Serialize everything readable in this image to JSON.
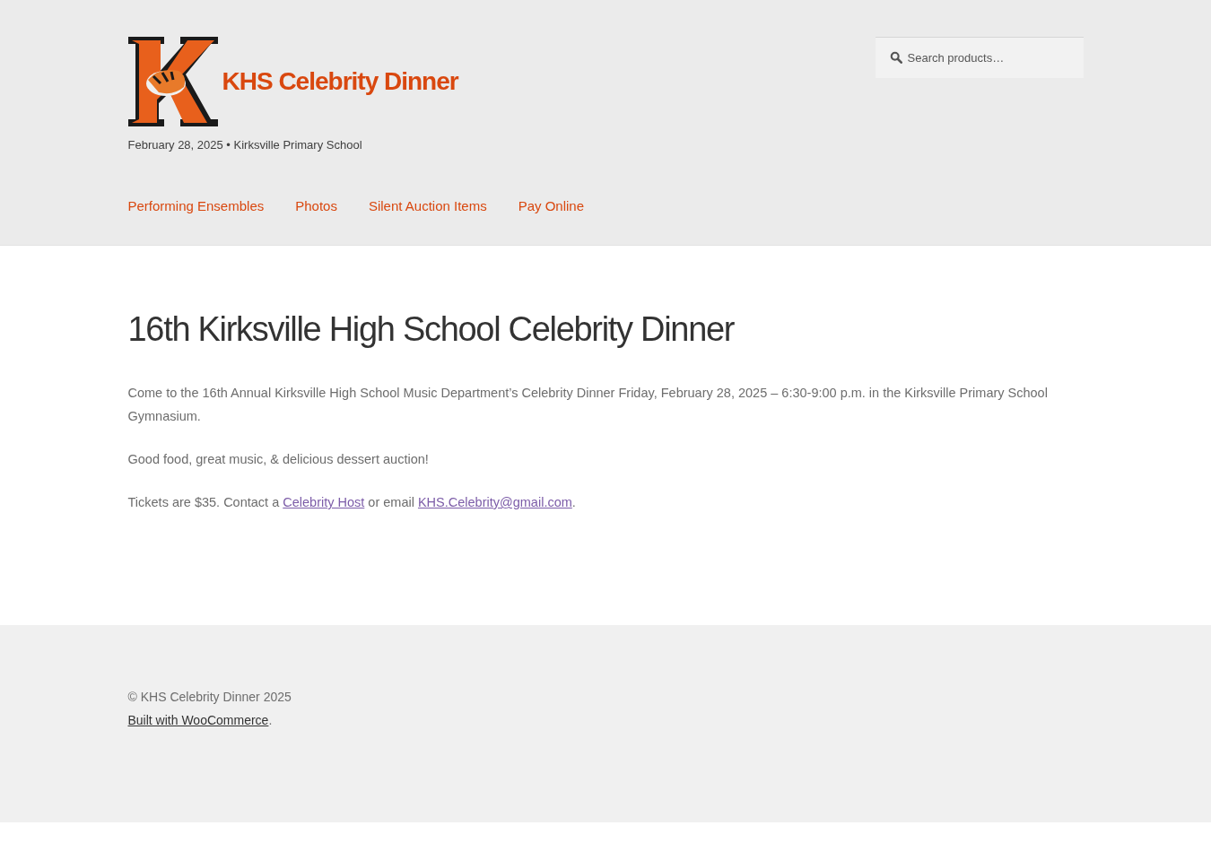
{
  "site": {
    "title": "KHS Celebrity Dinner",
    "tagline": "February 28, 2025 • Kirksville Primary School"
  },
  "search": {
    "placeholder": "Search products…"
  },
  "nav": [
    {
      "label": "Performing Ensembles"
    },
    {
      "label": "Photos"
    },
    {
      "label": "Silent Auction Items"
    },
    {
      "label": "Pay Online"
    }
  ],
  "page": {
    "heading": "16th Kirksville High School Celebrity Dinner",
    "paragraphs": [
      [
        {
          "kind": "text",
          "text": "Come to the 16th Annual Kirksville High School Music Department’s Celebrity Dinner Friday, February 28, 2025 – 6:30-9:00 p.m. in the Kirksville Primary School Gymnasium."
        }
      ],
      [
        {
          "kind": "text",
          "text": "Good food, great music, & delicious dessert auction!"
        }
      ],
      [
        {
          "kind": "text",
          "text": "Tickets are $35. Contact a "
        },
        {
          "kind": "link",
          "text": "Celebrity Host"
        },
        {
          "kind": "text",
          "text": " or email "
        },
        {
          "kind": "link",
          "text": "KHS.Celebrity@gmail.com"
        },
        {
          "kind": "text",
          "text": "."
        }
      ]
    ]
  },
  "footer": {
    "copyright": "© KHS Celebrity Dinner 2025",
    "credit": [
      {
        "kind": "link",
        "text": "Built with WooCommerce"
      },
      {
        "kind": "text",
        "text": "."
      }
    ]
  }
}
